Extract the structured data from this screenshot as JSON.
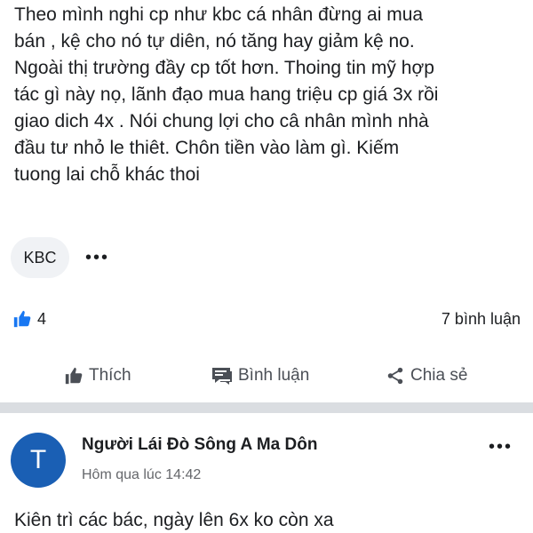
{
  "post": {
    "text": "Theo mình nghi cp như kbc cá nhân đừng ai mua\nbán , kệ cho nó tự diên, nó tăng hay giảm kệ no.\nNgoài thị trường đầy cp tốt hơn. Thoing tin mỹ hợp\ntác gì này nọ, lãnh đạo mua hang triệu cp giá 3x rồi\ngiao dich 4x . Nói chung lợi cho câ nhân mình nhà\nđầu tư nhỏ le thiêt. Chôn tiền vào làm gì. Kiếm\ntuong lai chỗ khác thoi",
    "tag": "KBC",
    "more": "•••"
  },
  "stats": {
    "likes": "4",
    "comments": "7 bình luận"
  },
  "actions": {
    "like": "Thích",
    "comment": "Bình luận",
    "share": "Chia sẻ"
  },
  "comment": {
    "avatar_letter": "T",
    "author": "Người Lái Đò Sông A Ma Dôn",
    "time": "Hôm qua lúc 14:42",
    "more": "•••",
    "text": "Kiên trì các bác, ngày lên 6x ko còn xa"
  },
  "colors": {
    "accent": "#1877f2",
    "avatar": "#1a5fb4",
    "separator": "#dadde1",
    "chip": "#f0f2f5"
  },
  "icons": {
    "like_badge": "thumbs-up-icon",
    "like_action": "thumbs-up-outline-icon",
    "comment_action": "speech-bubble-icon",
    "share_action": "share-icon"
  }
}
